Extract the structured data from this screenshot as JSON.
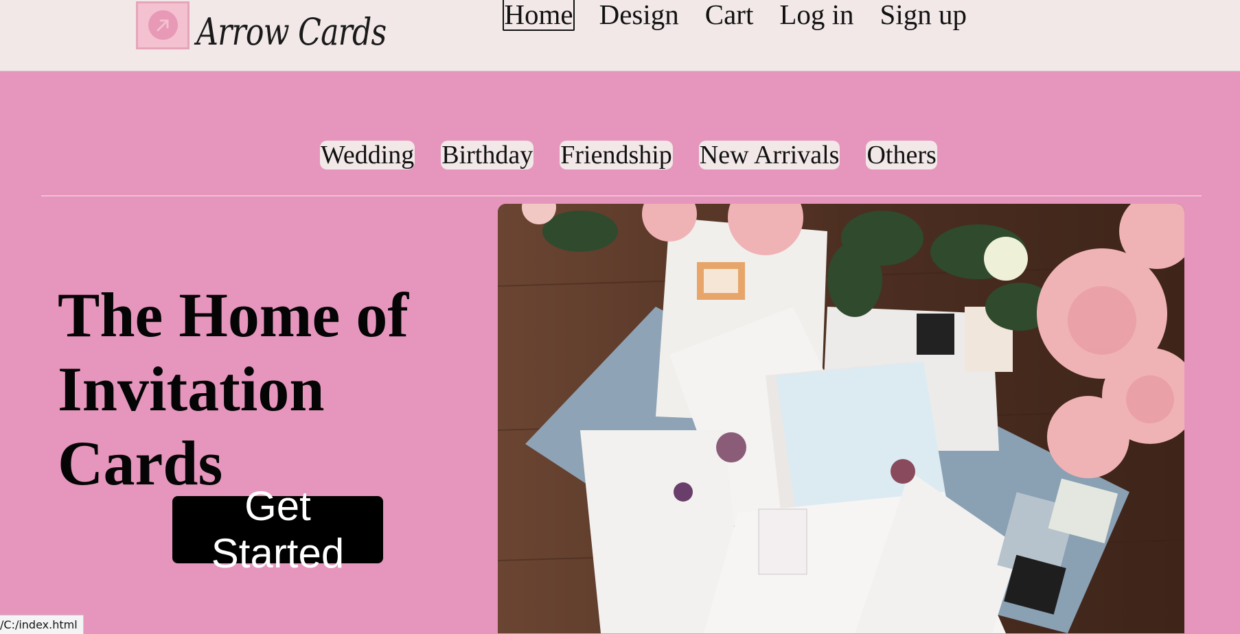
{
  "brand": {
    "name": "Arrow Cards",
    "logo_icon": "arrow-up-right-icon",
    "accent": "#e696bd",
    "bar": "#f2e8e8"
  },
  "nav": {
    "items": [
      "Home",
      "Design",
      "Cart",
      "Log in",
      "Sign up"
    ],
    "active": "Home"
  },
  "categories": [
    "Wedding",
    "Birthday",
    "Friendship",
    "New Arrivals",
    "Others"
  ],
  "hero": {
    "headline": "The Home of Invitation Cards",
    "cta_label": "Get Started",
    "image_subject": "envelopes-and-roses-photo"
  },
  "status_bar": {
    "url": "/C:/index.html"
  }
}
